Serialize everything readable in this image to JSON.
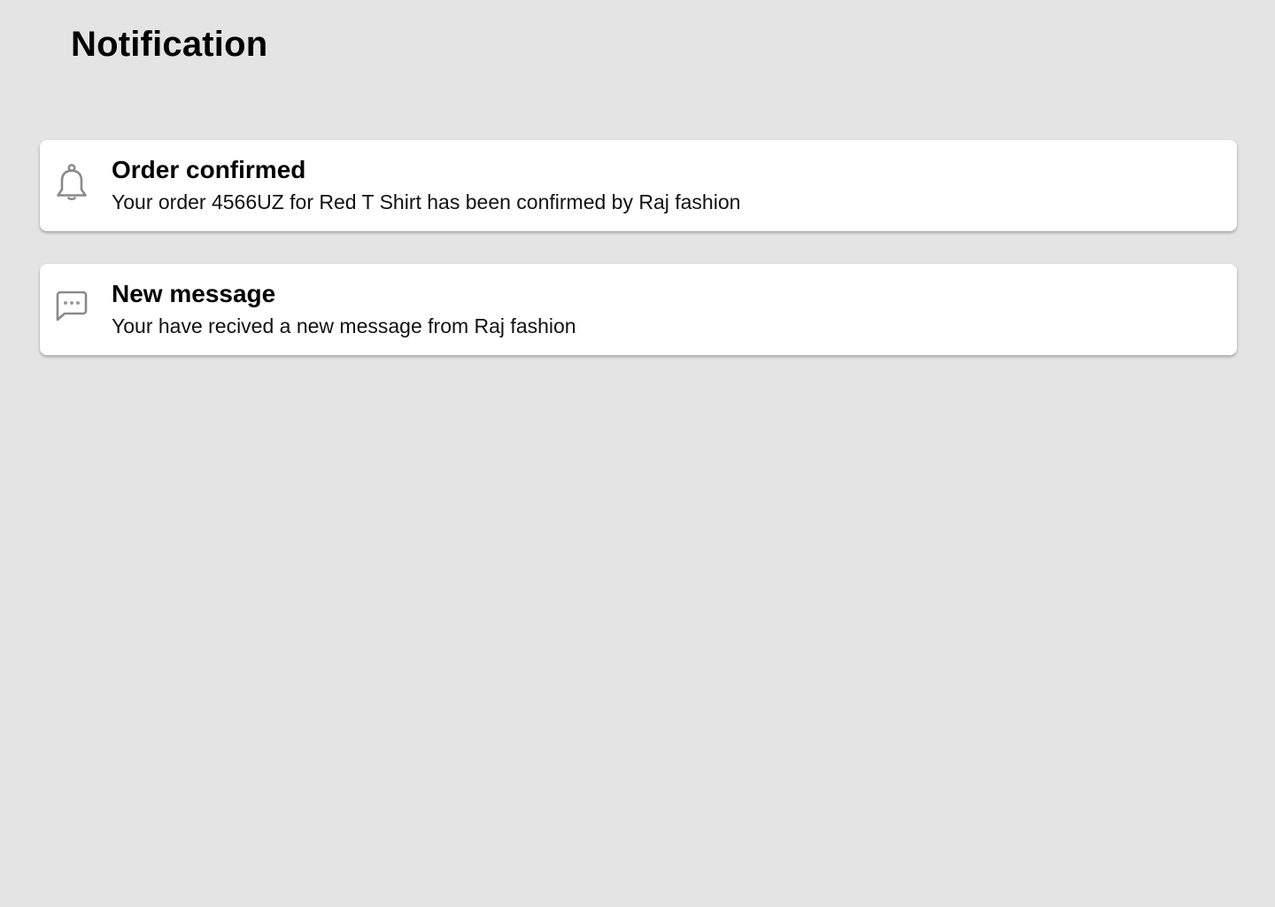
{
  "header": {
    "title": "Notification"
  },
  "notifications": [
    {
      "icon": "bell-icon",
      "title": "Order confirmed",
      "body": "Your order 4566UZ for Red T Shirt has been confirmed by Raj fashion"
    },
    {
      "icon": "message-icon",
      "title": "New message",
      "body": "Your have recived a new message from Raj fashion"
    }
  ],
  "colors": {
    "background": "#e4e4e4",
    "card": "#ffffff",
    "icon": "#8a8a8a"
  }
}
